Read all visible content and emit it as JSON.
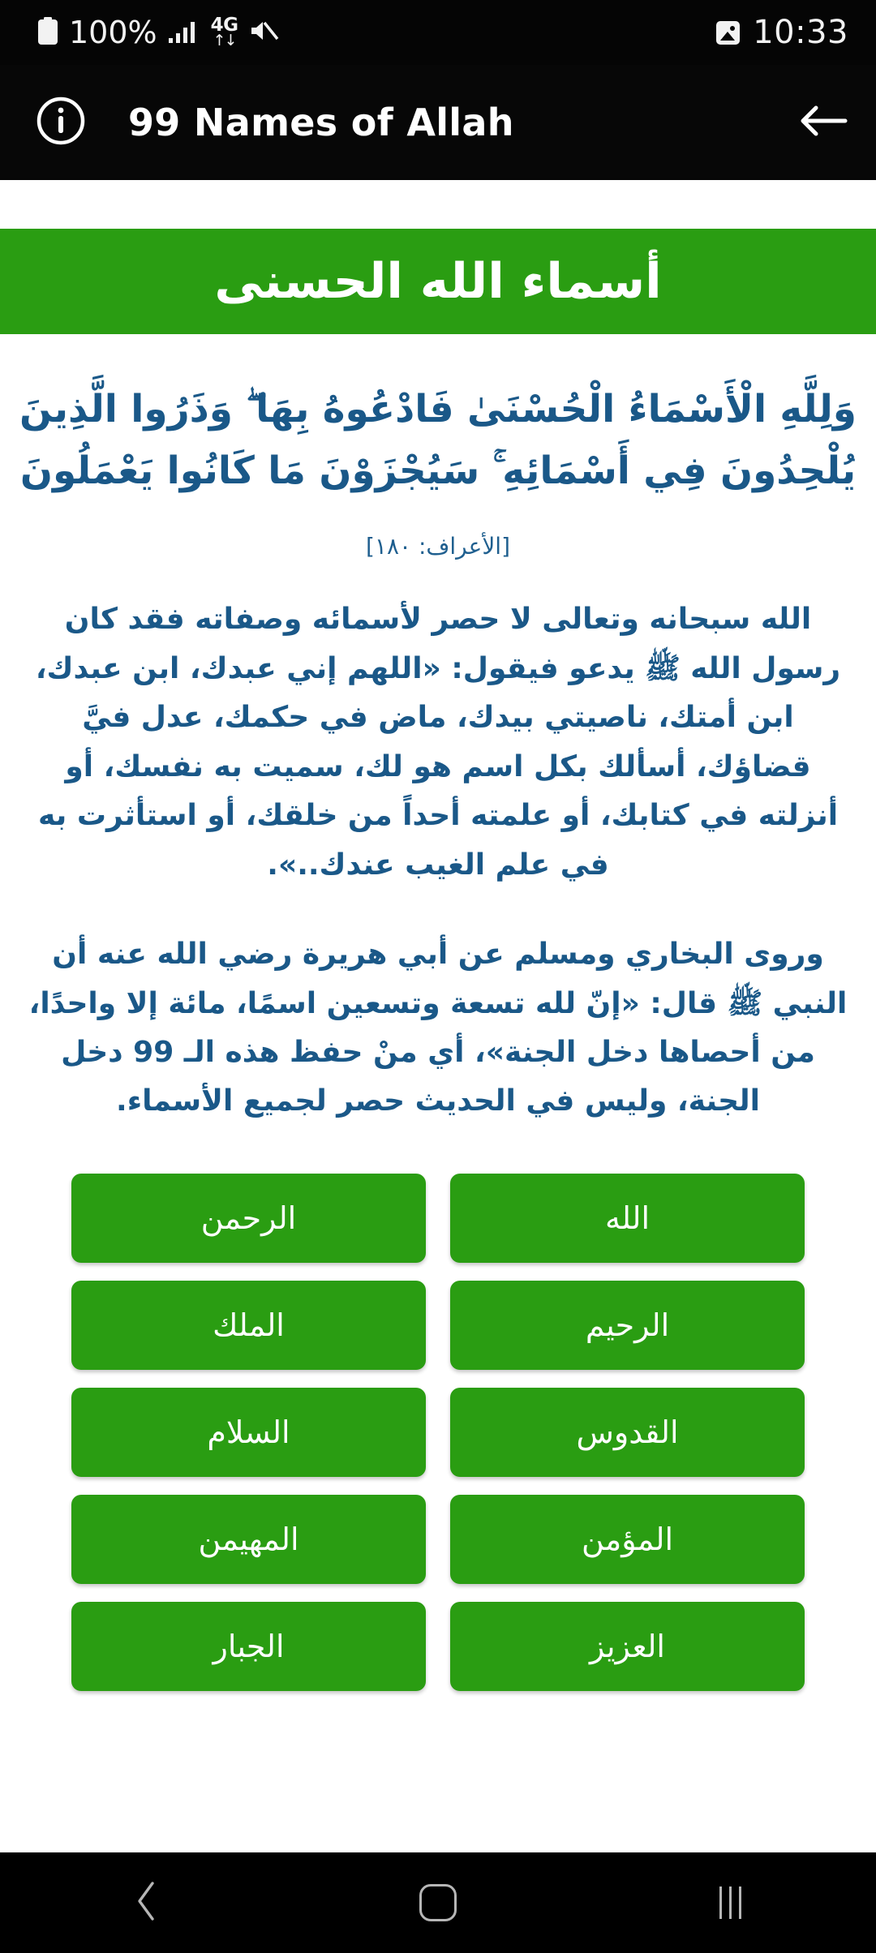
{
  "status_bar": {
    "time": "10:33",
    "screenshot_icon": "image-icon",
    "mute_icon": "mute-icon",
    "network_label": "4G",
    "network_arrows": "↓↑",
    "signal_icon": "signal-bars-icon",
    "battery_percent": "100%",
    "battery_icon": "battery-full-icon"
  },
  "app_bar": {
    "back_icon": "back-arrow-icon",
    "title": "99 Names of Allah",
    "info_icon": "info-icon"
  },
  "banner": {
    "title": "أسماء الله الحسنى"
  },
  "content": {
    "ayah_line1": "وَلِلَّهِ الْأَسْمَاءُ الْحُسْنَىٰ فَادْعُوهُ بِهَا ۖ وَذَرُوا الَّذِينَ",
    "ayah_line2": "يُلْحِدُونَ فِي أَسْمَائِهِ ۚ سَيُجْزَوْنَ مَا كَانُوا يَعْمَلُونَ",
    "ayah_reference": "[الأعراف: ١٨٠]",
    "paragraph1": "الله سبحانه وتعالى لا حصر لأسمائه وصفاته فقد كان رسول الله ﷺ يدعو فيقول: «اللهم إني عبدك، ابن عبدك، ابن أمتك، ناصيتي بيدك، ماض في حكمك، عدل فيَّ قضاؤك، أسألك بكل اسم هو لك، سميت به نفسك، أو أنزلته في كتابك، أو علمته أحداً من خلقك، أو استأثرت به في علم الغيب عندك..».",
    "paragraph2": "وروى البخاري ومسلم عن أبي هريرة رضي الله عنه أن النبي ﷺ قال: «إنّ لله تسعة وتسعين اسمًا، مائة إلا واحدًا، من أحصاها دخل الجنة»، أي منْ حفظ هذه الـ 99 دخل الجنة، وليس في الحديث حصر لجميع الأسماء."
  },
  "names": [
    {
      "label": "الله"
    },
    {
      "label": "الرحمن"
    },
    {
      "label": "الرحيم"
    },
    {
      "label": "الملك"
    },
    {
      "label": "القدوس"
    },
    {
      "label": "السلام"
    },
    {
      "label": "المؤمن"
    },
    {
      "label": "المهيمن"
    },
    {
      "label": "العزيز"
    },
    {
      "label": "الجبار"
    }
  ],
  "nav_bar": {
    "recents_icon": "recents-icon",
    "home_icon": "home-icon",
    "back_icon": "nav-back-icon"
  },
  "colors": {
    "green": "#2a9d12",
    "blue_text": "#1a5888",
    "bar_black": "#070707"
  }
}
